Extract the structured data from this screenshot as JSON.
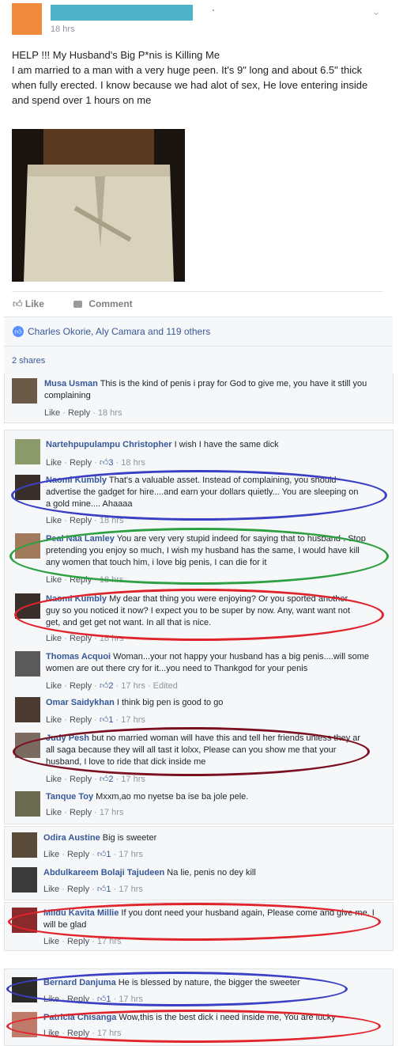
{
  "post": {
    "time": "18 hrs",
    "text": "HELP !!! My Husband's Big P*nis is Killing Me\nI am married to a man with a very huge peen. It's 9\" long and about 6.5\" thick when fully erected. I know because we had alot of sex, He love entering inside and spend over 1 hours on me",
    "tick": "ˋ",
    "chevron": "⌄"
  },
  "actions": {
    "like": "Like",
    "comment": "Comment"
  },
  "likes": "Charles Okorie, Aly Camara and 119 others",
  "shares": "2 shares",
  "comment_meta": {
    "like": "Like",
    "reply": "Reply"
  },
  "comments": [
    {
      "name": "Musa Usman",
      "text": "This is the kind of penis i pray for God to give me, you have it still you complaining",
      "meta": "18 hrs"
    },
    {
      "name": "Nartehpupulampu Christopher",
      "text": "I wish I have the same dick",
      "likes": "3",
      "meta": "18 hrs"
    },
    {
      "name": "Naomi Kumbly",
      "text": "That's a valuable asset. Instead of complaining, you should advertise the gadget for hire....and earn your dollars quietly... You are sleeping on a gold mine.... Ahaaaa",
      "meta": "18 hrs"
    },
    {
      "name": "Peal Naa Lamley",
      "text": "You are very very stupid indeed for saying that to husband . Stop pretending you enjoy so much, I wish my husband has the same, I would have kill any women that touch him, i love big penis, I can die for it",
      "meta": "18 hrs"
    },
    {
      "name": "Naomi Kumbly",
      "text": "My dear that thing you were enjoying? Or you sported another guy so you noticed it now? I expect you to be super by now. Any, want want not get, and get get not want. In all that is nice.",
      "meta": "18 hrs"
    },
    {
      "name": "Thomas Acquoi",
      "text": "Woman...your not happy your husband has a big penis....will some women are out there cry for it...you need to Thankgod for your penis",
      "likes": "2",
      "meta": "17 hrs · Edited"
    },
    {
      "name": "Omar Saidykhan",
      "text": "I think big pen is good to go",
      "likes": "1",
      "meta": "17 hrs"
    },
    {
      "name": "Judy Pesh",
      "text": "but no married woman will have this and tell her friends unless they ar all saga because they will all tast it lolxx, Please can you show me that your husband, I love to ride that dick inside me",
      "likes": "2",
      "meta": "17 hrs"
    },
    {
      "name": "Tanque Toy",
      "text": "Mxxm,ao mo nyetse ba ise ba jole pele.",
      "meta": "17 hrs"
    },
    {
      "name": "Odira Austine",
      "text": "Big is sweeter",
      "likes": "1",
      "meta": "17 hrs"
    },
    {
      "name": "Abdulkareem Bolaji Tajudeen",
      "text": "Na lie, penis no dey kill",
      "likes": "1",
      "meta": "17 hrs"
    },
    {
      "name": "Mildu Kavita Millie",
      "text": "If you dont need your husband again, Please come and give me, I will be glad",
      "meta": "17 hrs"
    },
    {
      "name": "Bernard Danjuma",
      "text": "He is blessed by nature, the bigger the sweeter",
      "likes": "1",
      "meta": "17 hrs"
    },
    {
      "name": "Patricia Chisanga",
      "text": "Wow,this is the best dick i need inside me, You are lucky",
      "meta": "17 hrs"
    }
  ],
  "colors": {
    "link": "#365899",
    "oval_blue": "#3a3fc4",
    "oval_green": "#2ea043",
    "oval_red": "#e0242c",
    "oval_maroon": "#7a1020"
  }
}
